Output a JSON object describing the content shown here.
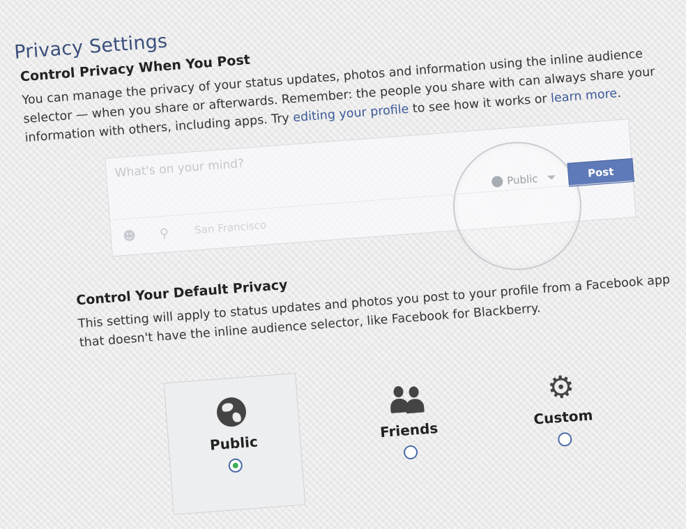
{
  "page": {
    "title": "Privacy Settings"
  },
  "post_section": {
    "title": "Control Privacy When You Post",
    "text_1": "You can manage the privacy of your status updates, photos and information using the inline audience selector — when you share or afterwards. Remember: the people you share with can always share your information with others, including apps. Try ",
    "link_edit": "editing your profile",
    "text_2": " to see how it works or ",
    "link_learn": "learn more",
    "text_3": "."
  },
  "composer": {
    "placeholder": "What's on your mind?",
    "location": "San Francisco",
    "audience_label": "Public",
    "post_label": "Post",
    "icons": [
      "tag-people-icon",
      "location-pin-icon",
      "globe-icon",
      "chevron-down-icon"
    ]
  },
  "default_section": {
    "title": "Control Your Default Privacy",
    "text": "This setting will apply to status updates and photos you post to your profile from a Facebook app that doesn't have the inline audience selector, like Facebook for Blackberry."
  },
  "privacy_options": [
    {
      "label": "Public",
      "icon": "globe-icon",
      "selected": true
    },
    {
      "label": "Friends",
      "icon": "friends-icon",
      "selected": false
    },
    {
      "label": "Custom",
      "icon": "gear-icon",
      "selected": false
    }
  ],
  "colors": {
    "title": "#3b4f7c",
    "link": "#3b5998",
    "post_button": "#5f7ab8",
    "radio_selected": "#3dae55"
  }
}
